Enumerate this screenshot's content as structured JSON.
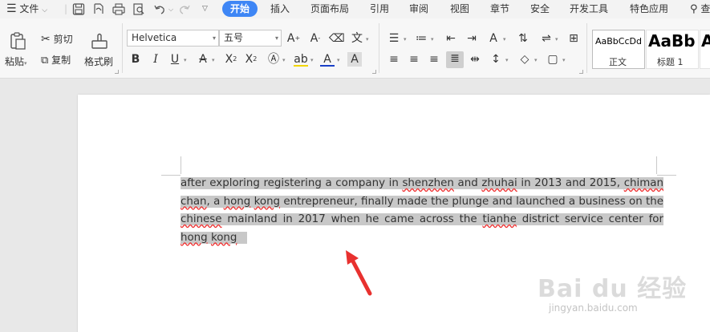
{
  "menubar": {
    "file_label": "文件",
    "tabs": [
      "开始",
      "插入",
      "页面布局",
      "引用",
      "审阅",
      "视图",
      "章节",
      "安全",
      "开发工具",
      "特色应用"
    ],
    "search_label": "查"
  },
  "ribbon": {
    "paste_label": "粘贴",
    "cut_label": "剪切",
    "copy_label": "复制",
    "format_painter_label": "格式刷",
    "font_name": "Helvetica",
    "font_size": "五号",
    "styles": [
      {
        "preview": "AaBbCcDd",
        "name": "正文"
      },
      {
        "preview": "AaBb",
        "name": "标题 1"
      },
      {
        "preview": "A",
        "name": ""
      }
    ]
  },
  "document": {
    "text_before": "after exploring registering a company in ",
    "w_shenzhen": "shenzhen",
    "t1": " and ",
    "w_zhuhai": "zhuhai",
    "t2": " in 2013 and 2015, ",
    "w_chiman": "chiman",
    "t3": " ",
    "w_chan": "chan",
    "t4": ", a ",
    "w_hong": "hong",
    "t5": " ",
    "w_kong": "kong",
    "t6": " entrepreneur, finally made the plunge and launched a business on the ",
    "w_chinese": "chinese",
    "t7": " mainland in 2017 when he came across the ",
    "w_tianhe": "tianhe",
    "t8": " district service center for ",
    "w_hong2": "hong",
    "t9": " ",
    "w_kong2": "kong"
  },
  "watermark": {
    "main": "Bai du 经验",
    "sub": "jingyan.baidu.com"
  },
  "colors": {
    "accent": "#3e86f5",
    "selection": "#c8c8c8",
    "arrow": "#e8312f"
  }
}
